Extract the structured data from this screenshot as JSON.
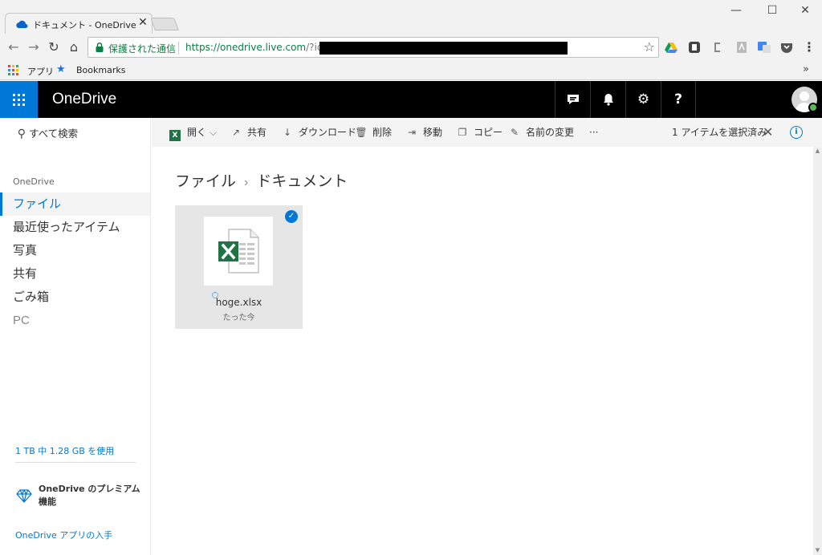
{
  "browser": {
    "tab_title": "ドキュメント - OneDrive",
    "secure_label": "保護された通信",
    "url_host": "https://onedrive.live.com",
    "url_rest": "/?id=",
    "bookmarks": {
      "apps_label": "アプリ",
      "bookmarks_label": "Bookmarks",
      "more": "»"
    }
  },
  "topbar": {
    "brand": "OneDrive"
  },
  "leftnav": {
    "search_label": "すべて検索",
    "section_label": "OneDrive",
    "items": [
      {
        "label": "ファイル",
        "active": true
      },
      {
        "label": "最近使ったアイテム"
      },
      {
        "label": "写真"
      },
      {
        "label": "共有"
      },
      {
        "label": "ごみ箱"
      },
      {
        "label": "PC"
      }
    ],
    "storage_text": "1 TB 中 1.28 GB を使用",
    "premium_text": "OneDrive のプレミアム機能",
    "get_apps_text": "OneDrive アプリの入手"
  },
  "commandbar": {
    "open": "開く",
    "share": "共有",
    "download": "ダウンロード",
    "delete": "削除",
    "move": "移動",
    "copy": "コピー",
    "rename": "名前の変更",
    "more": "···",
    "selection": "1 アイテムを選択済み"
  },
  "breadcrumb": {
    "root": "ファイル",
    "current": "ドキュメント"
  },
  "files": [
    {
      "name": "hoge.xlsx",
      "modified": "たった今",
      "type": "excel",
      "selected": true
    }
  ],
  "colors": {
    "accent": "#0078d7",
    "excel": "#217346",
    "topbar": "#000000"
  }
}
